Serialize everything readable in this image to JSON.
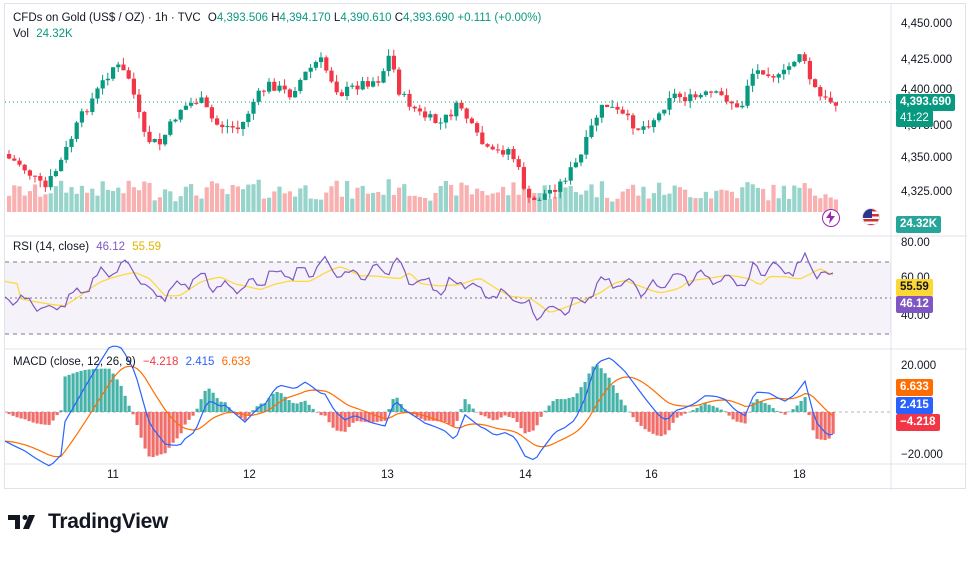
{
  "header": {
    "symbol": "CFDs on Gold (US$ / OZ)",
    "interval": "1h",
    "exchange": "TVC",
    "open_label": "O",
    "open": "4,393.506",
    "high_label": "H",
    "high": "4,394.170",
    "low_label": "L",
    "low": "4,390.610",
    "close_label": "C",
    "close": "4,393.690",
    "change": "+0.111 (+0.00%)",
    "vol_label": "Vol",
    "vol": "24.32K"
  },
  "price_axis": {
    "ticks": [
      "4,450.000",
      "4,425.000",
      "4,400.000",
      "4,375.000",
      "4,350.000",
      "4,325.000"
    ],
    "last_price": "4,393.690",
    "countdown": "41:22",
    "volume_badge": "24.32K"
  },
  "rsi": {
    "title": "RSI (14, close)",
    "value": "46.12",
    "ma_value": "55.59",
    "ticks": [
      "80.00",
      "60.00",
      "40.00"
    ]
  },
  "macd": {
    "title": "MACD (close, 12, 26, 9)",
    "hist": "−4.218",
    "macd": "2.415",
    "signal": "6.633",
    "ticks": [
      "20.000",
      "−20.000"
    ]
  },
  "time_axis": [
    "11",
    "12",
    "13",
    "14",
    "16",
    "18"
  ],
  "colors": {
    "up": "#089981",
    "down": "#f23645",
    "rsi": "#7e57c2",
    "rsi_ma": "#fdd835",
    "macd": "#2962ff",
    "signal": "#ff6d00",
    "price_badge": "#089981"
  },
  "icons": [
    "lightning-icon",
    "us-flag-icon"
  ],
  "brand": "TradingView"
}
